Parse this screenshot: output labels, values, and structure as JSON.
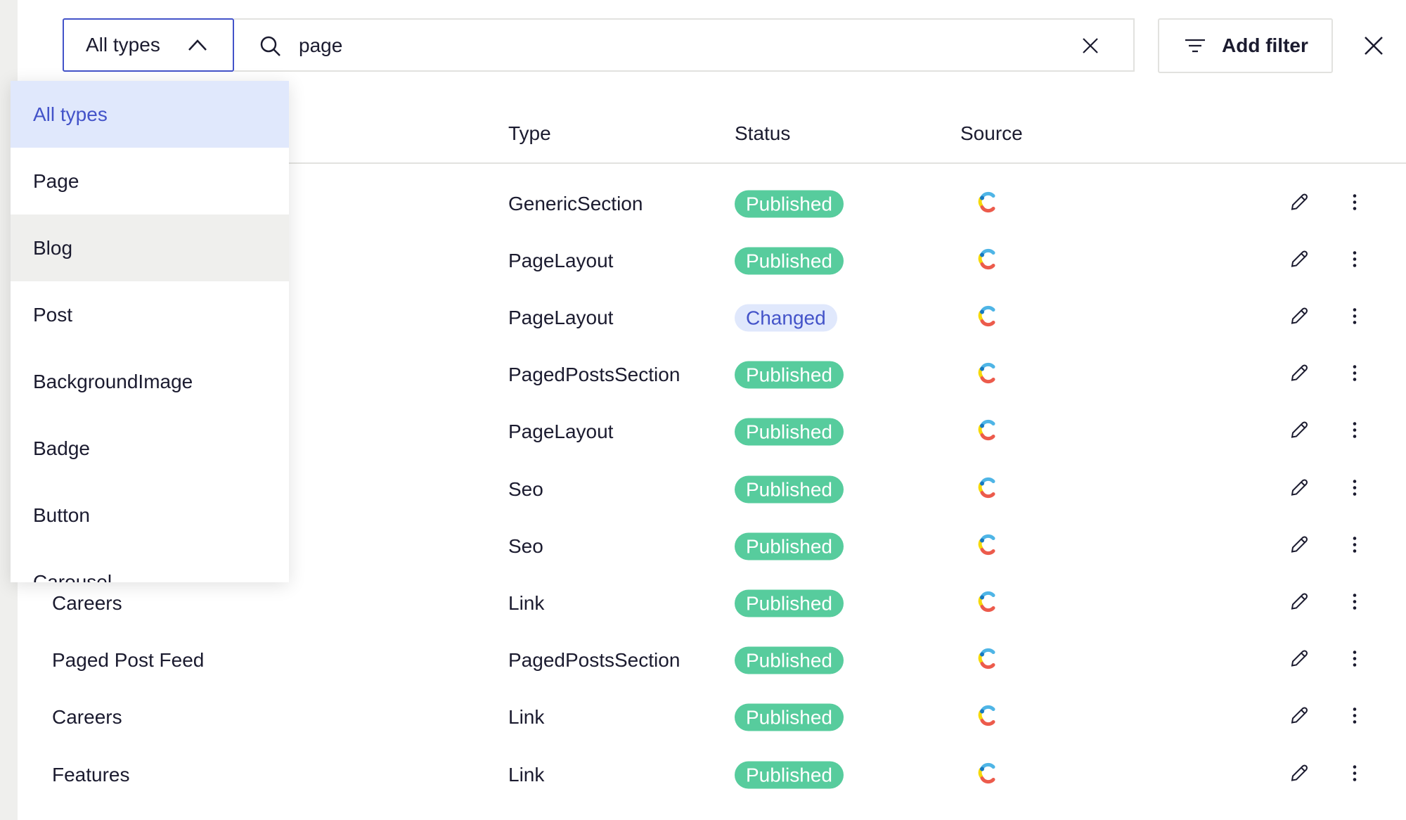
{
  "toolbar": {
    "type_select_value": "All types",
    "search_value": "page",
    "search_placeholder": "Search",
    "add_filter_label": "Add filter"
  },
  "dropdown": {
    "items": [
      {
        "label": "All types",
        "state": "selected"
      },
      {
        "label": "Page",
        "state": ""
      },
      {
        "label": "Blog",
        "state": "hover"
      },
      {
        "label": "Post",
        "state": ""
      },
      {
        "label": "BackgroundImage",
        "state": ""
      },
      {
        "label": "Badge",
        "state": ""
      },
      {
        "label": "Button",
        "state": ""
      },
      {
        "label": "Carousel",
        "state": ""
      }
    ]
  },
  "table": {
    "headers": {
      "type": "Type",
      "status": "Status",
      "source": "Source"
    },
    "rows": [
      {
        "name": "",
        "type": "GenericSection",
        "status": "Published"
      },
      {
        "name": "",
        "type": "PageLayout",
        "status": "Published"
      },
      {
        "name": "",
        "type": "PageLayout",
        "status": "Changed"
      },
      {
        "name": "",
        "type": "PagedPostsSection",
        "status": "Published"
      },
      {
        "name": "",
        "type": "PageLayout",
        "status": "Published"
      },
      {
        "name": "",
        "type": "Seo",
        "status": "Published"
      },
      {
        "name": "",
        "type": "Seo",
        "status": "Published"
      },
      {
        "name": "Careers",
        "type": "Link",
        "status": "Published"
      },
      {
        "name": "Paged Post Feed",
        "type": "PagedPostsSection",
        "status": "Published"
      },
      {
        "name": "Careers",
        "type": "Link",
        "status": "Published"
      },
      {
        "name": "Features",
        "type": "Link",
        "status": "Published"
      }
    ]
  },
  "colors": {
    "accent": "#4353c9",
    "published": "#57cc9d",
    "changed_bg": "#e0e8fc"
  },
  "icons": {
    "source": "contentful-logo-icon",
    "edit": "pencil-icon",
    "more": "kebab-menu-icon"
  }
}
